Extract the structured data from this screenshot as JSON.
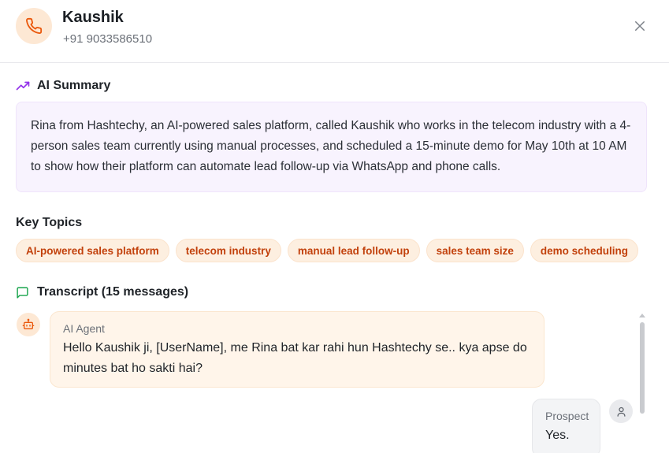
{
  "contact": {
    "name": "Kaushik",
    "phone": "+91 9033586510",
    "avatar_icon": "phone-icon"
  },
  "header": {
    "close_icon": "close-icon"
  },
  "summary": {
    "title": "AI Summary",
    "icon": "trending-up-icon",
    "text": "Rina from Hashtechy, an AI-powered sales platform, called Kaushik who works in the telecom industry with a 4-person sales team currently using manual processes, and scheduled a 15-minute demo for May 10th at 10 AM to show how their platform can automate lead follow-up via WhatsApp and phone calls."
  },
  "key_topics": {
    "title": "Key Topics",
    "items": [
      "AI-powered sales platform",
      "telecom industry",
      "manual lead follow-up",
      "sales team size",
      "demo scheduling"
    ]
  },
  "transcript": {
    "title": "Transcript (15 messages)",
    "icon": "message-square-icon",
    "messages": [
      {
        "sender": "AI Agent",
        "text": "Hello Kaushik ji, [UserName], me Rina bat kar rahi hun Hashtechy se.. kya apse do minutes bat ho sakti hai?",
        "avatar_icon": "bot-icon"
      },
      {
        "sender": "Prospect",
        "text": "Yes.",
        "avatar_icon": "user-icon"
      }
    ]
  },
  "colors": {
    "accent_orange": "#c2410c",
    "chip_bg": "#fdefe0",
    "summary_bg": "#f8f3fe",
    "summary_icon": "#9333ea",
    "transcript_icon": "#16a34a"
  }
}
